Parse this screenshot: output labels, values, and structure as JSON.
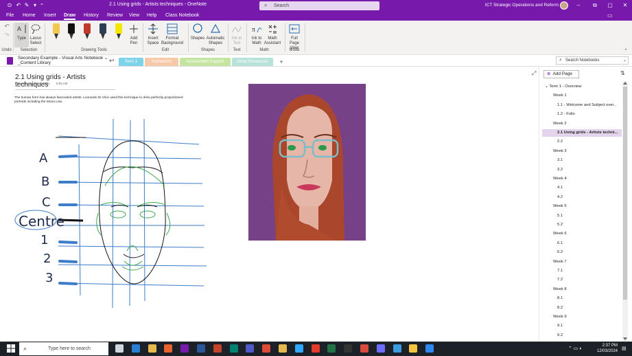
{
  "app": {
    "window_title": "2.1 Using grids - Artists techniques  -  OneNote",
    "search_placeholder": "Search",
    "org_name": "ICT Strategic Operations and Reform"
  },
  "menu": {
    "tabs": [
      "File",
      "Home",
      "Insert",
      "Draw",
      "History",
      "Review",
      "View",
      "Help",
      "Class Notebook"
    ],
    "active": "Draw"
  },
  "ribbon": {
    "type_label": "Type",
    "lasso_label": "Lasso Select",
    "add_pen_label": "Add Pen",
    "insert_space_label": "Insert Space",
    "format_background_label": "Format Background",
    "shapes_label": "Shapes",
    "automatic_shapes_label": "Automatic Shapes",
    "ink_to_text_label": "Ink to Text",
    "ink_to_math_label": "Ink to Math",
    "math_assistant_label": "Math Assistant",
    "full_page_view_label": "Full Page View",
    "groups": {
      "undo": "Undo",
      "selection": "Selection",
      "drawing_tools": "Drawing Tools",
      "edit": "Edit",
      "shapes": "Shapes",
      "text": "Text",
      "math": "Math",
      "mode": "Mode"
    },
    "pen_colors": [
      "#f2c94c",
      "#111111",
      "#c0392b",
      "#2c3e50",
      "#f5e600"
    ]
  },
  "notebook": {
    "name": "Secondary Example - Visual Arts Notebook",
    "subtitle": "_Content Library",
    "sections": [
      {
        "label": "Term 1",
        "color": "#7fd3e8",
        "active": true
      },
      {
        "label": "Homework",
        "color": "#f7c9a8",
        "active": false
      },
      {
        "label": "Assessment Support",
        "color": "#c5e4a0",
        "active": false
      },
      {
        "label": "Other Resources",
        "color": "#b7e2d7",
        "active": false
      }
    ],
    "search_placeholder": "Search Notebooks"
  },
  "page": {
    "title": "2.1 Using grids - Artists techniques",
    "date": "Thursday, 11 March 2021",
    "time": "8:50 AM",
    "body": "The human form has always fascinated artists.  Leonardo Di Vinci used this  technique to drew perfectly proportioned portraits including the Mona Lisa."
  },
  "drawing": {
    "labels": [
      "A",
      "B",
      "C",
      "Centre",
      "1",
      "2",
      "3"
    ]
  },
  "pages_panel": {
    "add_page_label": "Add Page",
    "items": [
      {
        "label": "Term 1 - Overview",
        "level": 0,
        "selected": false
      },
      {
        "label": "Week 1",
        "level": 1,
        "selected": false
      },
      {
        "label": "1.1 - Welcome and Subject over...",
        "level": 2,
        "selected": false
      },
      {
        "label": "1.2 - Folio",
        "level": 2,
        "selected": false
      },
      {
        "label": "Week 2",
        "level": 1,
        "selected": false
      },
      {
        "label": "2.1 Using grids - Artists techni...",
        "level": 2,
        "selected": true
      },
      {
        "label": "2.2",
        "level": 2,
        "selected": false
      },
      {
        "label": "Week 3",
        "level": 1,
        "selected": false
      },
      {
        "label": "3.1",
        "level": 2,
        "selected": false
      },
      {
        "label": "3.2",
        "level": 2,
        "selected": false
      },
      {
        "label": "Week 4",
        "level": 1,
        "selected": false
      },
      {
        "label": "4.1",
        "level": 2,
        "selected": false
      },
      {
        "label": "4.2",
        "level": 2,
        "selected": false
      },
      {
        "label": "Week 5",
        "level": 1,
        "selected": false
      },
      {
        "label": "5.1",
        "level": 2,
        "selected": false
      },
      {
        "label": "5.2",
        "level": 2,
        "selected": false
      },
      {
        "label": "Week 6",
        "level": 1,
        "selected": false
      },
      {
        "label": "6.1",
        "level": 2,
        "selected": false
      },
      {
        "label": "6.2",
        "level": 2,
        "selected": false
      },
      {
        "label": "Week 7",
        "level": 1,
        "selected": false
      },
      {
        "label": "7.1",
        "level": 2,
        "selected": false
      },
      {
        "label": "7.2",
        "level": 2,
        "selected": false
      },
      {
        "label": "Week 8",
        "level": 1,
        "selected": false
      },
      {
        "label": "8.1",
        "level": 2,
        "selected": false
      },
      {
        "label": "8.2",
        "level": 2,
        "selected": false
      },
      {
        "label": "Week 9",
        "level": 1,
        "selected": false
      },
      {
        "label": "9.1",
        "level": 2,
        "selected": false
      },
      {
        "label": "9.2",
        "level": 2,
        "selected": false
      }
    ]
  },
  "taskbar": {
    "search_placeholder": "Type here to search",
    "time": "2:37 PM",
    "date": "12/03/2024",
    "apps": [
      "task-view",
      "edge",
      "file-explorer",
      "firefox",
      "onenote",
      "word",
      "powerpoint",
      "sway",
      "teams",
      "chrome",
      "explorer-folder",
      "photoshop",
      "acrobat",
      "excel",
      "cmd",
      "app-red",
      "media",
      "edge-browser",
      "notes",
      "photos"
    ]
  }
}
